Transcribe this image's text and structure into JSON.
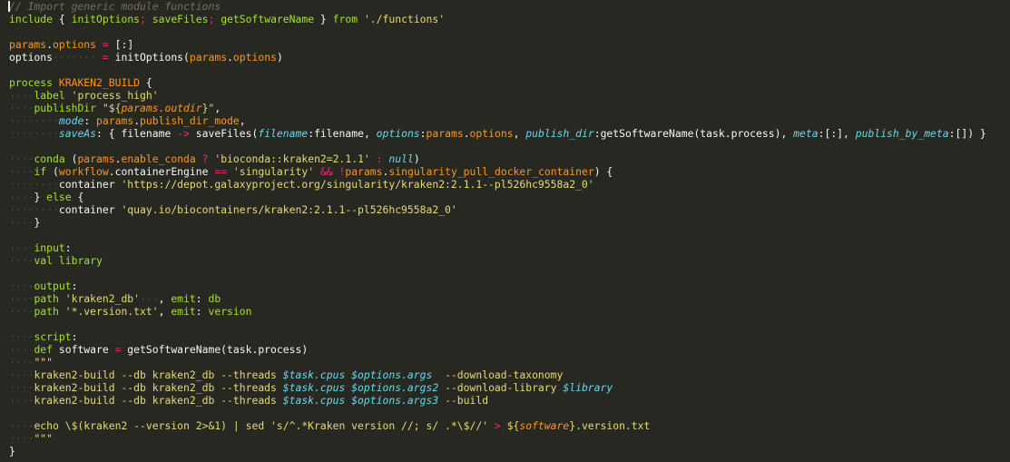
{
  "colors": {
    "background": "#272822",
    "keyword": "#a6e22e",
    "string": "#e6db74",
    "entity": "#fd971f",
    "operator": "#f92672",
    "comment": "#75715e",
    "param": "#66d9ef",
    "text": "#f8f8f2"
  },
  "lines": [
    [
      [
        "comment",
        "// Import generic module functions"
      ]
    ],
    [
      [
        "kw",
        "include"
      ],
      [
        "plain",
        " { "
      ],
      [
        "kw",
        "initOptions"
      ],
      [
        "op",
        "; "
      ],
      [
        "kw",
        "saveFiles"
      ],
      [
        "op",
        "; "
      ],
      [
        "kw",
        "getSoftwareName"
      ],
      [
        "plain",
        " } "
      ],
      [
        "kw",
        "from"
      ],
      [
        "plain",
        " "
      ],
      [
        "str",
        "'./functions'"
      ]
    ],
    [],
    [
      [
        "ent",
        "params"
      ],
      [
        "plain",
        "."
      ],
      [
        "ent",
        "options"
      ],
      [
        "plain",
        " "
      ],
      [
        "op",
        "="
      ],
      [
        "plain",
        " [:]"
      ]
    ],
    [
      [
        "plain",
        "options"
      ],
      [
        "ws",
        "·······"
      ],
      [
        "plain",
        " "
      ],
      [
        "op",
        "="
      ],
      [
        "plain",
        " initOptions("
      ],
      [
        "ent",
        "params"
      ],
      [
        "plain",
        "."
      ],
      [
        "ent",
        "options"
      ],
      [
        "plain",
        ")"
      ]
    ],
    [],
    [
      [
        "kw",
        "process"
      ],
      [
        "plain",
        " "
      ],
      [
        "ent",
        "KRAKEN2_BUILD"
      ],
      [
        "plain",
        " {"
      ]
    ],
    [
      [
        "ws",
        "····"
      ],
      [
        "kw",
        "label"
      ],
      [
        "plain",
        " "
      ],
      [
        "str",
        "'process_high'"
      ]
    ],
    [
      [
        "ws",
        "····"
      ],
      [
        "kw",
        "publishDir"
      ],
      [
        "plain",
        " "
      ],
      [
        "str",
        "\"${"
      ],
      [
        "var",
        "params.outdir"
      ],
      [
        "str",
        "}\""
      ],
      [
        "plain",
        ","
      ]
    ],
    [
      [
        "ws",
        "········"
      ],
      [
        "prm",
        "mode"
      ],
      [
        "plain",
        ": "
      ],
      [
        "ent",
        "params"
      ],
      [
        "plain",
        "."
      ],
      [
        "ent",
        "publish_dir_mode"
      ],
      [
        "plain",
        ","
      ]
    ],
    [
      [
        "ws",
        "········"
      ],
      [
        "prm",
        "saveAs"
      ],
      [
        "plain",
        ": { filename "
      ],
      [
        "op",
        "->"
      ],
      [
        "plain",
        " saveFiles("
      ],
      [
        "prm",
        "filename"
      ],
      [
        "plain",
        ":filename, "
      ],
      [
        "prm",
        "options"
      ],
      [
        "plain",
        ":"
      ],
      [
        "ent",
        "params"
      ],
      [
        "plain",
        "."
      ],
      [
        "ent",
        "options"
      ],
      [
        "plain",
        ", "
      ],
      [
        "prm",
        "publish_dir"
      ],
      [
        "plain",
        ":getSoftwareName(task.process), "
      ],
      [
        "prm",
        "meta"
      ],
      [
        "plain",
        ":[:], "
      ],
      [
        "prm",
        "publish_by_meta"
      ],
      [
        "plain",
        ":[]) }"
      ]
    ],
    [],
    [
      [
        "ws",
        "····"
      ],
      [
        "kw",
        "conda"
      ],
      [
        "plain",
        " ("
      ],
      [
        "ent",
        "params"
      ],
      [
        "plain",
        "."
      ],
      [
        "ent",
        "enable_conda"
      ],
      [
        "plain",
        " "
      ],
      [
        "op",
        "?"
      ],
      [
        "plain",
        " "
      ],
      [
        "str",
        "'bioconda::kraken2=2.1.1'"
      ],
      [
        "plain",
        " "
      ],
      [
        "op",
        ":"
      ],
      [
        "plain",
        " "
      ],
      [
        "prm",
        "null"
      ],
      [
        "plain",
        ")"
      ]
    ],
    [
      [
        "ws",
        "····"
      ],
      [
        "kw",
        "if"
      ],
      [
        "plain",
        " ("
      ],
      [
        "ent",
        "workflow"
      ],
      [
        "plain",
        ".containerEngine "
      ],
      [
        "op",
        "=="
      ],
      [
        "plain",
        " "
      ],
      [
        "str",
        "'singularity'"
      ],
      [
        "plain",
        " "
      ],
      [
        "op",
        "&&"
      ],
      [
        "plain",
        " "
      ],
      [
        "op",
        "!"
      ],
      [
        "ent",
        "params"
      ],
      [
        "plain",
        "."
      ],
      [
        "ent",
        "singularity_pull_docker_container"
      ],
      [
        "plain",
        ") {"
      ]
    ],
    [
      [
        "ws",
        "········"
      ],
      [
        "plain",
        "container "
      ],
      [
        "str",
        "'https://depot.galaxyproject.org/singularity/kraken2:2.1.1--pl526hc9558a2_0'"
      ]
    ],
    [
      [
        "ws",
        "····"
      ],
      [
        "plain",
        "} "
      ],
      [
        "kw",
        "else"
      ],
      [
        "plain",
        " {"
      ]
    ],
    [
      [
        "ws",
        "········"
      ],
      [
        "plain",
        "container "
      ],
      [
        "str",
        "'quay.io/biocontainers/kraken2:2.1.1--pl526hc9558a2_0'"
      ]
    ],
    [
      [
        "ws",
        "····"
      ],
      [
        "plain",
        "}"
      ]
    ],
    [],
    [
      [
        "ws",
        "····"
      ],
      [
        "kw",
        "input"
      ],
      [
        "plain",
        ":"
      ]
    ],
    [
      [
        "ws",
        "····"
      ],
      [
        "kw",
        "val"
      ],
      [
        "plain",
        " "
      ],
      [
        "kw",
        "library"
      ]
    ],
    [],
    [
      [
        "ws",
        "····"
      ],
      [
        "kw",
        "output"
      ],
      [
        "plain",
        ":"
      ]
    ],
    [
      [
        "ws",
        "····"
      ],
      [
        "kw",
        "path"
      ],
      [
        "plain",
        " "
      ],
      [
        "str",
        "'kraken2_db'"
      ],
      [
        "ws",
        "···"
      ],
      [
        "plain",
        ", "
      ],
      [
        "kw",
        "emit"
      ],
      [
        "plain",
        ": "
      ],
      [
        "kw",
        "db"
      ]
    ],
    [
      [
        "ws",
        "····"
      ],
      [
        "kw",
        "path"
      ],
      [
        "plain",
        " "
      ],
      [
        "str",
        "'*.version.txt'"
      ],
      [
        "plain",
        ", "
      ],
      [
        "kw",
        "emit"
      ],
      [
        "plain",
        ": "
      ],
      [
        "kw",
        "version"
      ]
    ],
    [],
    [
      [
        "ws",
        "····"
      ],
      [
        "kw",
        "script"
      ],
      [
        "plain",
        ":"
      ]
    ],
    [
      [
        "ws",
        "····"
      ],
      [
        "kw",
        "def"
      ],
      [
        "plain",
        " software "
      ],
      [
        "op",
        "="
      ],
      [
        "plain",
        " getSoftwareName(task.process)"
      ]
    ],
    [
      [
        "ws",
        "····"
      ],
      [
        "str",
        "\"\"\""
      ]
    ],
    [
      [
        "ws",
        "····"
      ],
      [
        "str",
        "kraken2-build --db kraken2_db --threads "
      ],
      [
        "prm",
        "$task.cpus"
      ],
      [
        "plain",
        " "
      ],
      [
        "prm",
        "$options.args"
      ],
      [
        "plain",
        "  "
      ],
      [
        "str",
        "--download-taxonomy"
      ]
    ],
    [
      [
        "ws",
        "····"
      ],
      [
        "str",
        "kraken2-build --db kraken2_db --threads "
      ],
      [
        "prm",
        "$task.cpus"
      ],
      [
        "plain",
        " "
      ],
      [
        "prm",
        "$options.args2"
      ],
      [
        "plain",
        " "
      ],
      [
        "str",
        "--download-library "
      ],
      [
        "prm",
        "$library"
      ]
    ],
    [
      [
        "ws",
        "····"
      ],
      [
        "str",
        "kraken2-build --db kraken2_db --threads "
      ],
      [
        "prm",
        "$task.cpus"
      ],
      [
        "plain",
        " "
      ],
      [
        "prm",
        "$options.args3"
      ],
      [
        "plain",
        " "
      ],
      [
        "str",
        "--build"
      ]
    ],
    [],
    [
      [
        "ws",
        "····"
      ],
      [
        "str",
        "echo \\$(kraken2 --version 2>&1) | sed 's/^.*Kraken version //; s/ .*\\$//' "
      ],
      [
        "op",
        ">"
      ],
      [
        "plain",
        " "
      ],
      [
        "str",
        "${"
      ],
      [
        "var",
        "software"
      ],
      [
        "str",
        "}.version.txt"
      ]
    ],
    [
      [
        "ws",
        "····"
      ],
      [
        "str",
        "\"\"\""
      ]
    ],
    [
      [
        "plain",
        "}"
      ]
    ]
  ]
}
